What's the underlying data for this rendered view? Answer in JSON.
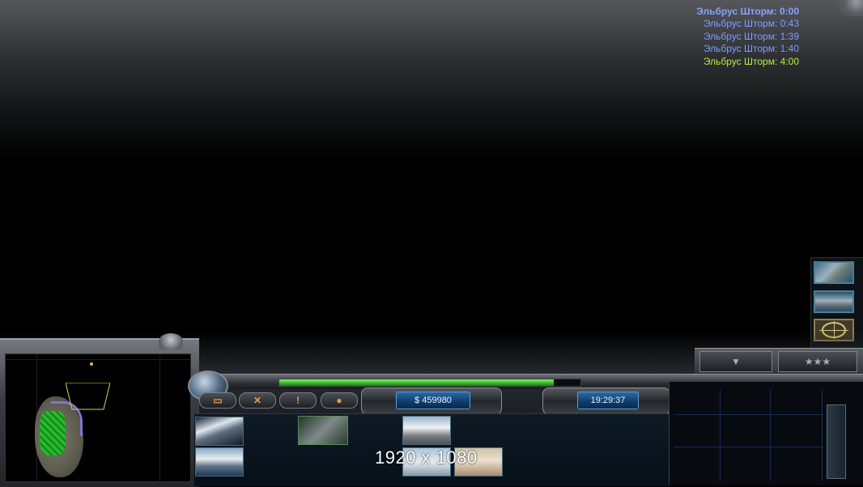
{
  "timers": [
    {
      "text": "Эльбрус Шторм: 0:00",
      "style": "first"
    },
    {
      "text": "Эльбрус Шторм: 0:43",
      "style": "mid"
    },
    {
      "text": "Эльбрус Шторм: 1:39",
      "style": "mid"
    },
    {
      "text": "Эльбрус Шторм: 1:40",
      "style": "mid"
    },
    {
      "text": "Эльбрус Шторм: 4:00",
      "style": "last"
    }
  ],
  "hud": {
    "money": "$ 459980",
    "clock": "19:29:37",
    "power_fraction": 0.91,
    "resolution_label": "1920 x 1080"
  },
  "command_buttons": [
    {
      "name": "sell-button",
      "icon": "monitor-icon",
      "glyph": "▭"
    },
    {
      "name": "repair-button",
      "icon": "wrench-icon",
      "glyph": "✕"
    },
    {
      "name": "alert-button",
      "icon": "exclamation-icon",
      "glyph": "!"
    },
    {
      "name": "chat-button",
      "icon": "speech-bubble-icon",
      "glyph": "●"
    }
  ],
  "colors": {
    "timer_first": "#8aa2ff",
    "timer_mid": "#7f9dff",
    "timer_last": "#b8e84a",
    "power_bar": "#3bc12c",
    "readout_bg": "#0f3b69"
  }
}
